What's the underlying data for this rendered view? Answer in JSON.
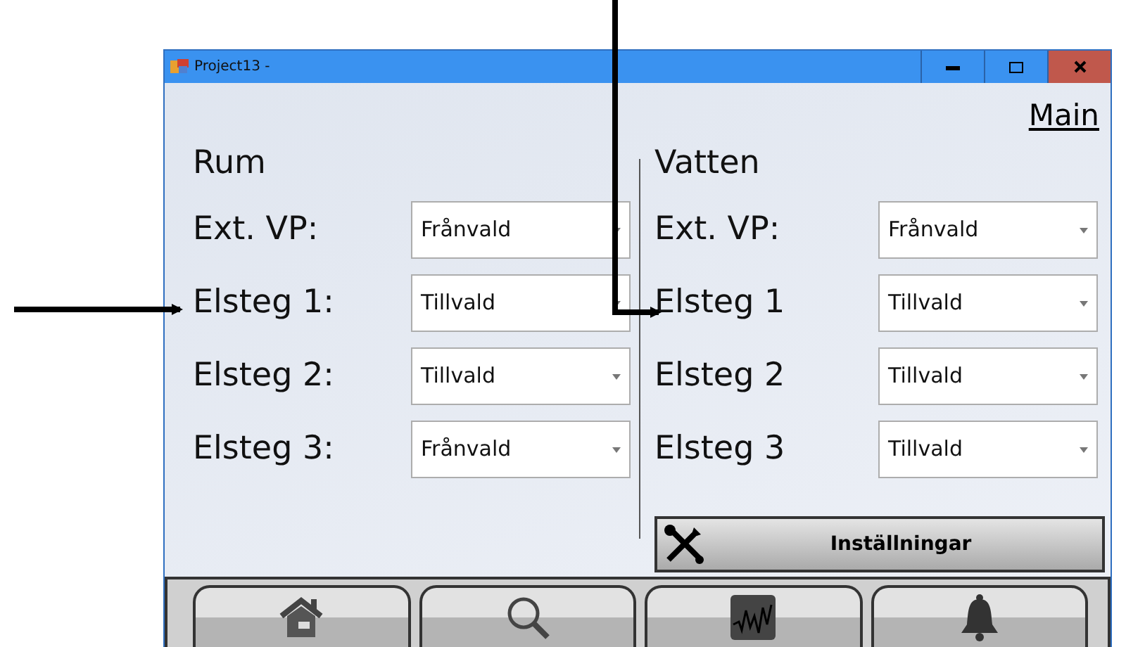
{
  "window": {
    "title": "Project13 -"
  },
  "main_link": "Main",
  "groups": [
    {
      "heading": "Rum",
      "rows": [
        {
          "label": "Ext. VP:",
          "value": "Frånvald"
        },
        {
          "label": "Elsteg 1:",
          "value": "Tillvald"
        },
        {
          "label": "Elsteg 2:",
          "value": "Tillvald"
        },
        {
          "label": "Elsteg 3:",
          "value": "Frånvald"
        }
      ]
    },
    {
      "heading": "Vatten",
      "rows": [
        {
          "label": "Ext. VP:",
          "value": "Frånvald"
        },
        {
          "label": "Elsteg 1",
          "value": "Tillvald"
        },
        {
          "label": "Elsteg 2",
          "value": "Tillvald"
        },
        {
          "label": "Elsteg 3",
          "value": "Tillvald"
        }
      ]
    }
  ],
  "settings_button": "Inställningar",
  "nav_buttons": [
    {
      "kind": "home"
    },
    {
      "kind": "search"
    },
    {
      "kind": "chart"
    },
    {
      "kind": "bell"
    }
  ]
}
